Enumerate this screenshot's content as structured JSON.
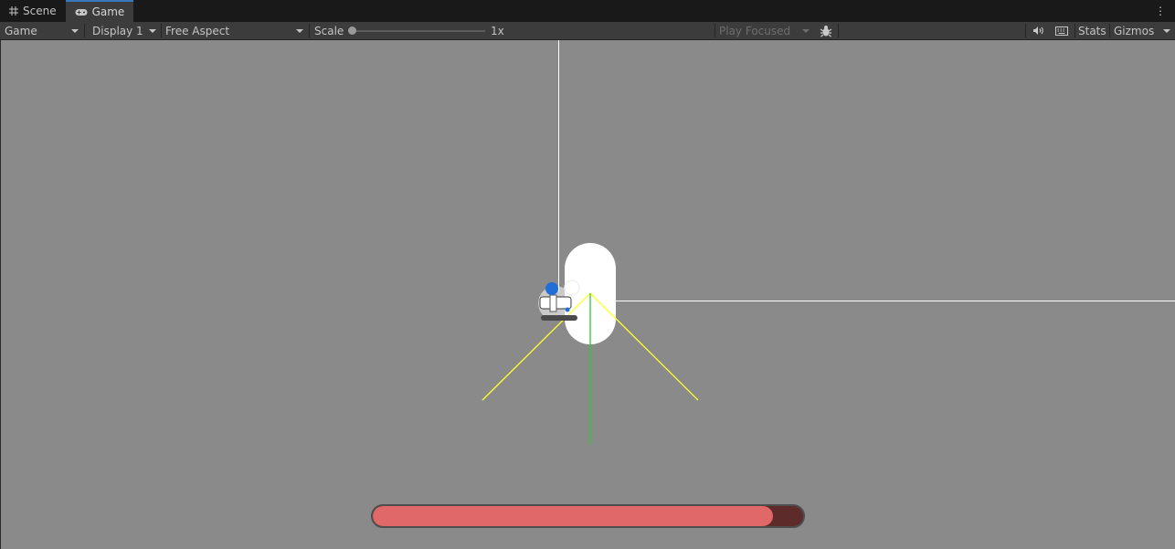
{
  "tabs": [
    {
      "label": "Scene",
      "icon": "grid-icon",
      "active": false
    },
    {
      "label": "Game",
      "icon": "gamepad-icon",
      "active": true
    }
  ],
  "toolbar": {
    "game_dropdown": "Game",
    "display_dropdown": "Display 1",
    "aspect_dropdown": "Free Aspect",
    "scale_label": "Scale",
    "scale_value": "1x",
    "play_mode_dropdown": "Play Focused",
    "stats_label": "Stats",
    "gizmos_label": "Gizmos",
    "icons": [
      "bug-icon",
      "speaker-icon",
      "keyboard-icon",
      "kebab-menu-icon"
    ]
  },
  "scene": {
    "player_health_fraction": 0.93,
    "colors": {
      "background": "#8a8a8a",
      "health_fill": "#e06868",
      "health_empty": "#5e2b2b",
      "vision_cone": "#ffff2e",
      "forward_axis": "#2ecc2e",
      "reference_lines": "#ffffff",
      "player_marker": "#1f6fd6"
    }
  }
}
